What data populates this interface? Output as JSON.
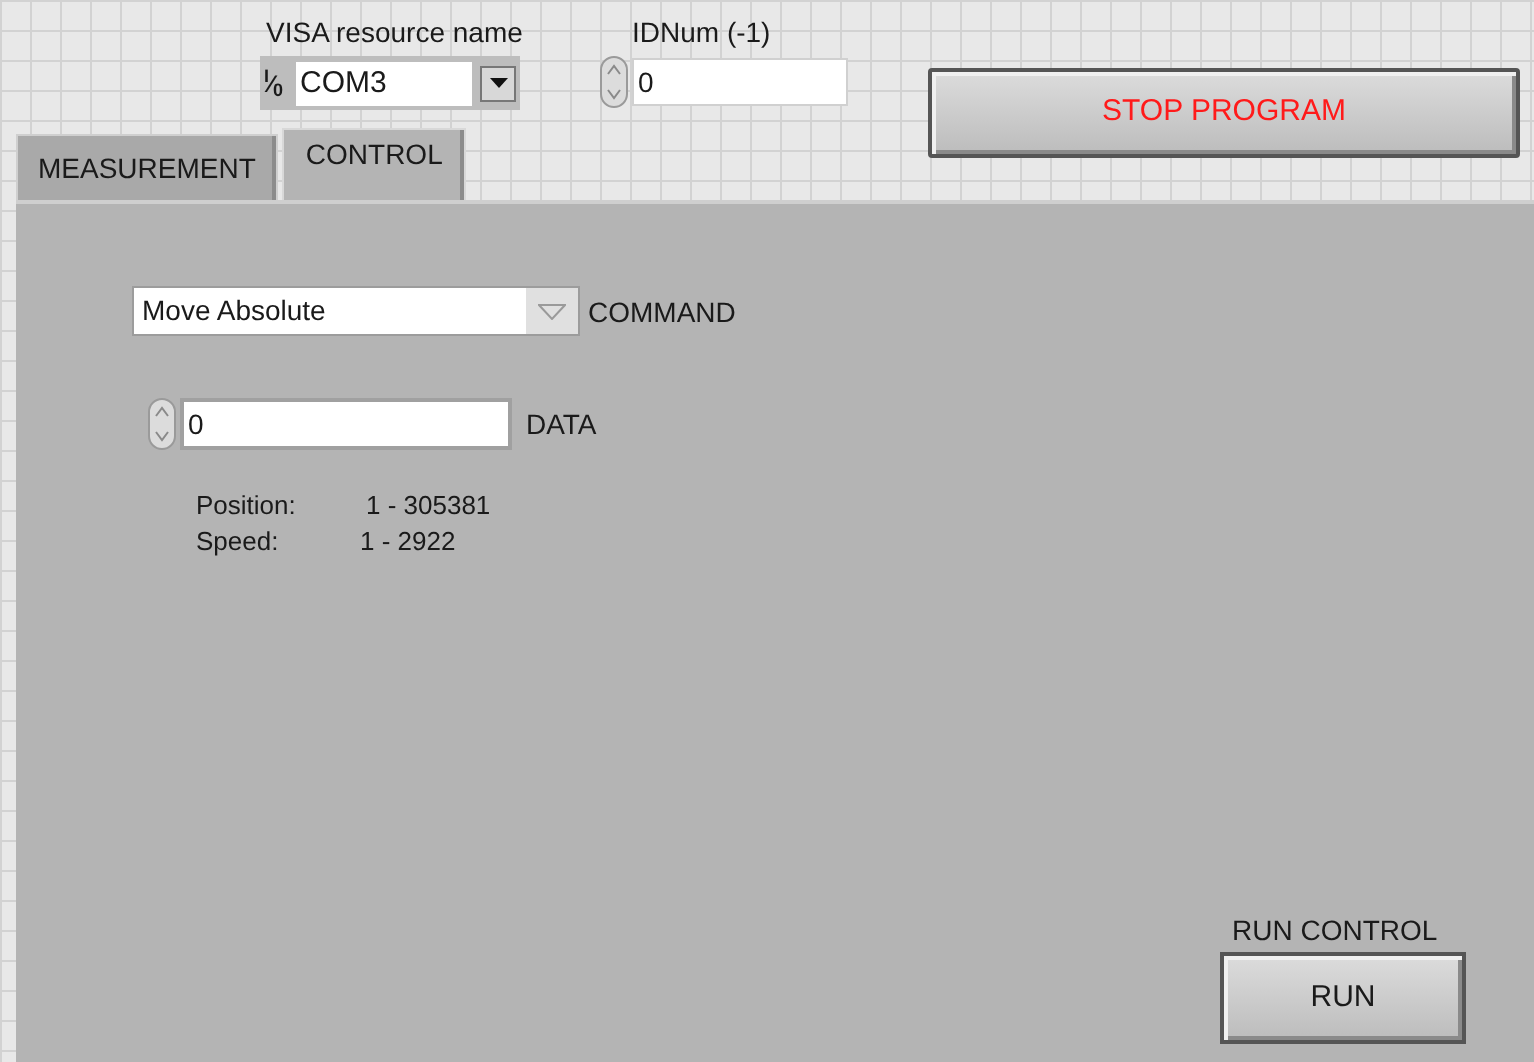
{
  "visa_resource": {
    "label": "VISA resource name",
    "prefix": "$^{I}$⁄$_{0}$",
    "value": "COM3"
  },
  "id_num": {
    "label": "IDNum (-1)",
    "value": "0"
  },
  "stop_button": {
    "label": "STOP PROGRAM"
  },
  "tabs": [
    {
      "label": "MEASUREMENT",
      "selected": false
    },
    {
      "label": "CONTROL",
      "selected": true
    }
  ],
  "command": {
    "value": "Move Absolute",
    "label": "COMMAND"
  },
  "data": {
    "value": "0",
    "label": "DATA"
  },
  "notes": [
    {
      "name": "Position:",
      "range": "1 - 305381"
    },
    {
      "name": "Speed:",
      "range": "1 - 2922"
    }
  ],
  "run_control": {
    "label": "RUN CONTROL",
    "button": "RUN"
  }
}
